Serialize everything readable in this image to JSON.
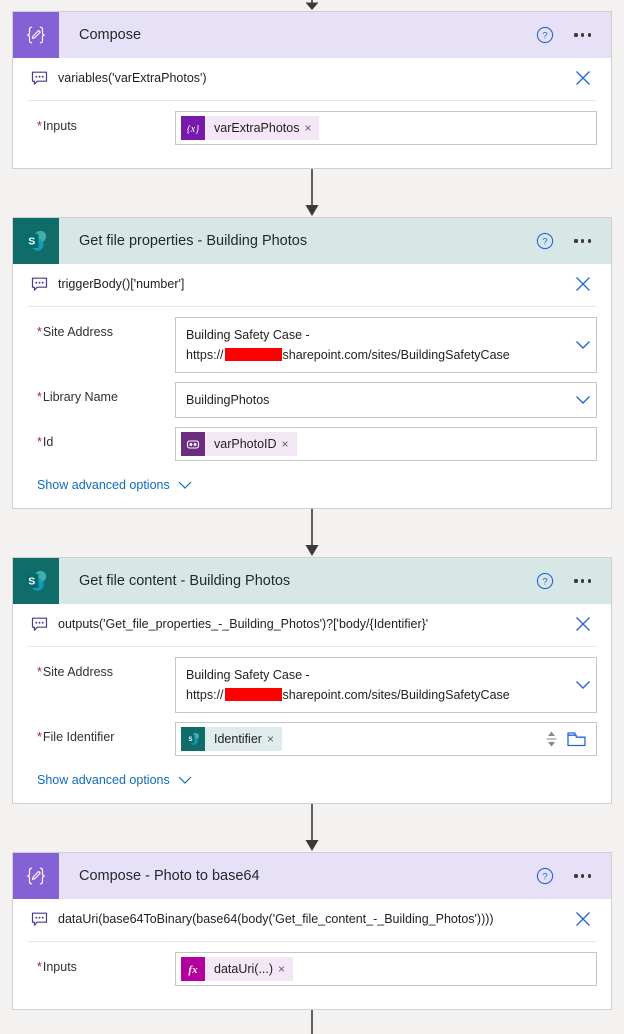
{
  "flow": {
    "app": "Power Automate flow designer",
    "connectors": [
      "arrow-down",
      "arrow-down",
      "arrow-down",
      "arrow-down",
      "line-down"
    ],
    "cards": [
      {
        "id": "compose",
        "type": "compose",
        "title": "Compose",
        "icon": "compose-braces-pencil-icon",
        "help_label": "?",
        "menu_label": "…",
        "description": "variables('varExtraPhotos')",
        "fields": [
          {
            "label": "Inputs",
            "required": true,
            "kind": "token",
            "token": {
              "text": "varExtraPhotos",
              "icon": "variable-token-icon",
              "remove": "×"
            }
          }
        ],
        "advanced": null
      },
      {
        "id": "get-file-properties",
        "type": "sharepoint",
        "title": "Get file properties - Building Photos",
        "icon": "sharepoint-icon",
        "help_label": "?",
        "menu_label": "…",
        "description": "triggerBody()['number']",
        "fields": [
          {
            "label": "Site Address",
            "required": true,
            "kind": "dropdown-two-line",
            "line1": "Building Safety Case -",
            "line2_prefix": "https://",
            "line2_redacted": true,
            "line2_suffix": "sharepoint.com/sites/BuildingSafetyCase"
          },
          {
            "label": "Library Name",
            "required": true,
            "kind": "dropdown",
            "value": "BuildingPhotos"
          },
          {
            "label": "Id",
            "required": true,
            "kind": "token",
            "token": {
              "text": "varPhotoID",
              "icon": "variable-id-token-icon",
              "remove": "×"
            }
          }
        ],
        "advanced": "Show advanced options"
      },
      {
        "id": "get-file-content",
        "type": "sharepoint",
        "title": "Get file content - Building Photos",
        "icon": "sharepoint-icon",
        "help_label": "?",
        "menu_label": "…",
        "description": "outputs('Get_file_properties_-_Building_Photos')?['body/{Identifier}'",
        "fields": [
          {
            "label": "Site Address",
            "required": true,
            "kind": "dropdown-two-line",
            "line1": "Building Safety Case -",
            "line2_prefix": "https://",
            "line2_redacted": true,
            "line2_suffix": "sharepoint.com/sites/BuildingSafetyCase"
          },
          {
            "label": "File Identifier",
            "required": true,
            "kind": "token-picker",
            "token": {
              "text": "Identifier",
              "icon": "sharepoint-token-icon",
              "remove": "×"
            },
            "trailing": [
              "spinner-icon",
              "folder-picker-icon"
            ]
          }
        ],
        "advanced": "Show advanced options"
      },
      {
        "id": "compose-photo-to-base64",
        "type": "compose",
        "title": "Compose - Photo to base64",
        "icon": "compose-braces-pencil-icon",
        "help_label": "?",
        "menu_label": "…",
        "description": "dataUri(base64ToBinary(base64(body('Get_file_content_-_Building_Photos'))))",
        "fields": [
          {
            "label": "Inputs",
            "required": true,
            "kind": "token",
            "token": {
              "text": "dataUri(...)",
              "icon": "expression-fx-token-icon",
              "remove": "×"
            }
          }
        ],
        "advanced": null
      }
    ]
  },
  "colors": {
    "page_background": "#f3f2f1",
    "compose_header": "#e6e1f7",
    "compose_icon": "#8561d6",
    "sharepoint_header": "#d7e7e6",
    "sharepoint_icon": "#0f6c69",
    "token_background": "#f3e6f5",
    "variable_token_icon": "#7719aa",
    "variable_id_token_icon": "#6b2e7e",
    "expression_token_icon": "#b4009e",
    "link": "#0f6cbd",
    "required_asterisk": "#a4262c",
    "redaction": "#fd0000",
    "connector_arrow": "#3b3a39"
  }
}
